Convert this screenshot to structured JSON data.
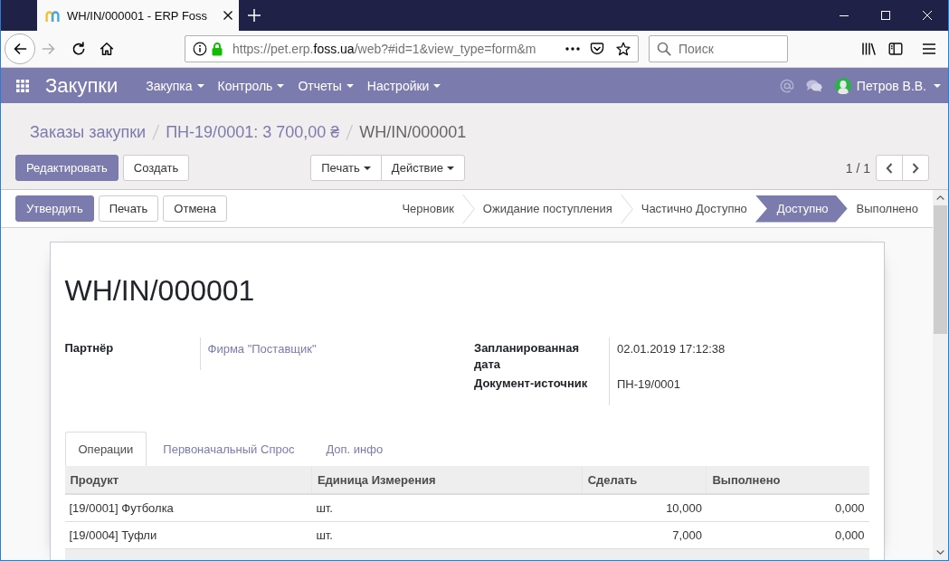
{
  "browser": {
    "tab_title": "WH/IN/000001 - ERP Foss",
    "url_parts": [
      {
        "text": "https://pet.erp.",
        "highlight": false
      },
      {
        "text": "foss.ua",
        "highlight": true
      },
      {
        "text": "/web?#id=1&view_type=form&m",
        "highlight": false
      }
    ],
    "forward_enabled": false,
    "search": {
      "placeholder": "Поиск"
    }
  },
  "app": {
    "title": "Закупки",
    "menus": [
      "Закупка",
      "Контроль",
      "Отчеты",
      "Настройки"
    ],
    "user": "Петров В.В."
  },
  "breadcrumbs": [
    {
      "label": "Заказы закупки",
      "link": true
    },
    {
      "label": "ПН-19/0001: 3 700,00 ₴",
      "link": true
    },
    {
      "label": "WH/IN/000001",
      "link": false
    }
  ],
  "buttons": [
    {
      "label": "Редактировать",
      "primary": true
    },
    {
      "label": "Создать",
      "primary": false
    }
  ],
  "dropdowns": [
    "Печать",
    "Действие"
  ],
  "pager": "1 / 1",
  "status_buttons": [
    {
      "label": "Утвердить",
      "primary": true
    },
    {
      "label": "Печать",
      "primary": false
    },
    {
      "label": "Отмена",
      "primary": false
    }
  ],
  "stages": [
    {
      "label": "Черновик",
      "selected": false
    },
    {
      "label": "Ожидание поступления",
      "selected": false
    },
    {
      "label": "Частично Доступно",
      "selected": false
    },
    {
      "label": "Доступно",
      "selected": true
    },
    {
      "label": "Выполнено",
      "selected": false
    }
  ],
  "record": {
    "title": "WH/IN/000001",
    "fields_left": [
      {
        "label": "Партнёр",
        "value": "Фирма \"Поставщик\"",
        "link": true
      }
    ],
    "fields_right": [
      {
        "label": "Запланированная дата",
        "value": "02.01.2019 17:12:38",
        "link": false
      },
      {
        "label": "Документ-источник",
        "value": "ПН-19/0001",
        "link": false
      }
    ]
  },
  "tabs": [
    {
      "label": "Операции",
      "selected": true
    },
    {
      "label": "Первоначальный Спрос",
      "selected": false
    },
    {
      "label": "Доп. инфо",
      "selected": false
    }
  ],
  "table": {
    "columns": [
      {
        "label": "Продукт",
        "kind": "text"
      },
      {
        "label": "Единица Измерения",
        "kind": "text"
      },
      {
        "label": "Сделать",
        "kind": "number"
      },
      {
        "label": "Выполнено",
        "kind": "number"
      }
    ],
    "rows": [
      [
        "[19/0001] Футболка",
        "шт.",
        "10,000",
        "0,000"
      ],
      [
        "[19/0004] Туфли",
        "шт.",
        "7,000",
        "0,000"
      ]
    ]
  }
}
